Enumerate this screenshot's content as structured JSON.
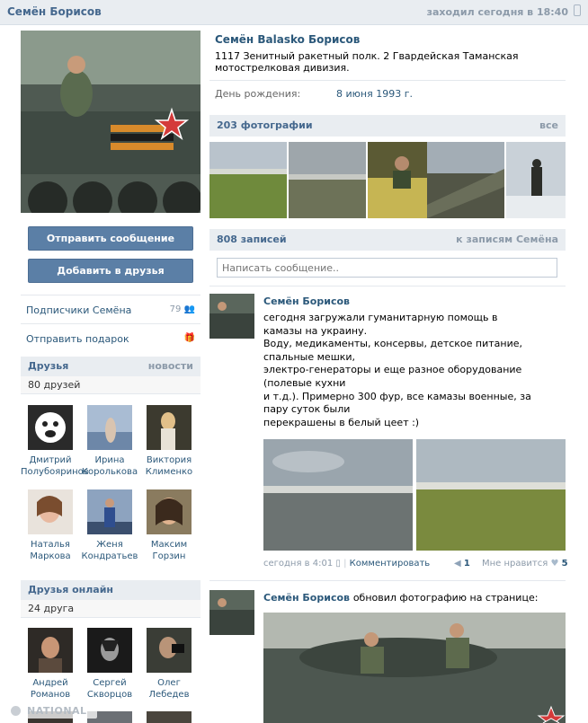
{
  "header": {
    "name": "Семён Борисов",
    "online": "заходил сегодня в 18:40"
  },
  "actions": {
    "send_message": "Отправить сообщение",
    "add_friend": "Добавить в друзья"
  },
  "left_links": {
    "subscribers": "Подписчики Семёна",
    "subscribers_count": "79",
    "gift": "Отправить подарок"
  },
  "friends": {
    "title": "Друзья",
    "news": "новости",
    "count_label": "80 друзей",
    "items": [
      {
        "first": "Дмитрий",
        "last": "Полубояринов"
      },
      {
        "first": "Ирина",
        "last": "Королькова"
      },
      {
        "first": "Виктория",
        "last": "Клименко"
      },
      {
        "first": "Наталья",
        "last": "Маркова"
      },
      {
        "first": "Женя",
        "last": "Кондратьев"
      },
      {
        "first": "Максим",
        "last": "Горзин"
      }
    ]
  },
  "online_friends": {
    "title": "Друзья онлайн",
    "count_label": "24 друга",
    "items": [
      {
        "first": "Андрей",
        "last": "Романов"
      },
      {
        "first": "Сергей",
        "last": "Скворцов"
      },
      {
        "first": "Олег",
        "last": "Лебедев"
      }
    ]
  },
  "profile": {
    "full_name": "Семён Balasko Борисов",
    "status": "1117 Зенитный ракетный полк. 2 Гвардейская Таманская мотострелковая дивизия.",
    "birthday_label": "День рождения:",
    "birthday_value": "8 июня 1993 г."
  },
  "photos": {
    "title": "203 фотографии",
    "all": "все"
  },
  "wall": {
    "title": "808 записей",
    "to_posts": "к записям Семёна",
    "placeholder": "Написать сообщение.."
  },
  "post1": {
    "author": "Семён Борисов",
    "lines": [
      "сегодня загружали гуманитарную помощь в камазы на украину.",
      "Воду, медикаменты, консервы, детское питание, спальные мешки,",
      "электро-генераторы и еще разное оборудование (полевые кухни",
      "и т.д.). Примерно 300 фур, все камазы военные, за пару суток были",
      "перекрашены в белый цеет :)"
    ],
    "time": "сегодня в 4:01",
    "comment": "Комментировать",
    "reposts": "1",
    "like_label": "Мне нравится",
    "likes": "5"
  },
  "post2": {
    "author": "Семён Борисов",
    "action": "обновил фотографию на странице:"
  },
  "watermark": "NATIONAL"
}
